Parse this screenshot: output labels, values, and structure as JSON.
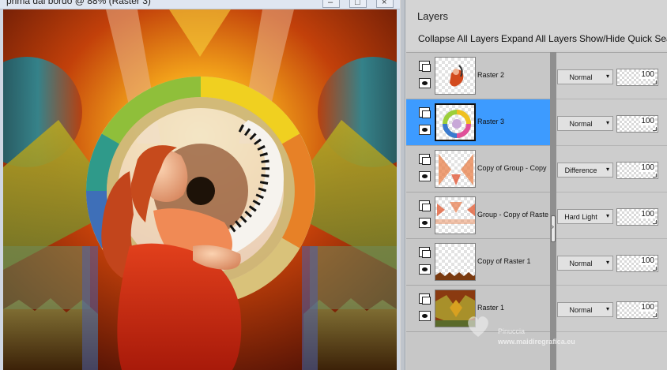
{
  "document": {
    "title": "prima dal bordo  @ 88% (Raster 3)",
    "window_controls": [
      "–",
      "□",
      "×"
    ]
  },
  "layers_panel": {
    "title": "Layers",
    "toolbar": {
      "collapse_all": "Collapse All Layers",
      "expand_all": "Expand All Layers",
      "show_hide_quick_search": "Show/Hide Quick Sea"
    },
    "layers": [
      {
        "name": "Raster 2",
        "blend_mode": "Normal",
        "opacity": "100",
        "selected": false
      },
      {
        "name": "Raster 3",
        "blend_mode": "Normal",
        "opacity": "100",
        "selected": true
      },
      {
        "name": "Copy of Group - Copy o",
        "blend_mode": "Difference",
        "opacity": "100",
        "selected": false
      },
      {
        "name": "Group - Copy of Raster",
        "blend_mode": "Hard Light",
        "opacity": "100",
        "selected": false
      },
      {
        "name": "Copy of Raster 1",
        "blend_mode": "Normal",
        "opacity": "100",
        "selected": false
      },
      {
        "name": "Raster 1",
        "blend_mode": "Normal",
        "opacity": "100",
        "selected": false
      }
    ],
    "dropdown_arrow": "▾",
    "splitter_arrow": "›",
    "selected_color": "#3d9bff"
  },
  "watermark": {
    "name": "Pinuccia",
    "url": "www.maidiregrafica.eu"
  }
}
